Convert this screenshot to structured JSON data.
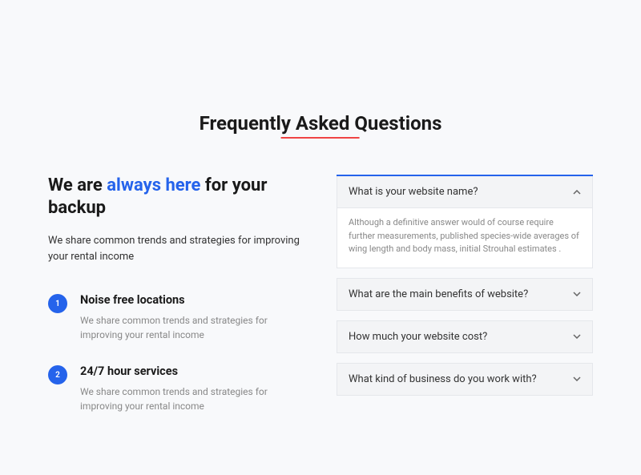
{
  "page_title": "Frequently Asked Questions",
  "subtitle": {
    "pre": "We are ",
    "highlight": "always here",
    "post": " for your backup"
  },
  "subtitle_desc": "We share common trends and strategies for improving your rental income",
  "features": [
    {
      "num": "1",
      "title": "Noise free locations",
      "desc": "We share common trends and strategies for improving your rental income"
    },
    {
      "num": "2",
      "title": "24/7 hour services",
      "desc": "We share common trends and strategies for improving your rental income"
    }
  ],
  "accordion": [
    {
      "title": "What is your website name?",
      "expanded": true,
      "body": "Although a definitive answer would of course require further measurements, published species-wide averages of wing length and body mass, initial Strouhal estimates ."
    },
    {
      "title": "What are the main benefits of website?",
      "expanded": false
    },
    {
      "title": "How much your website cost?",
      "expanded": false
    },
    {
      "title": "What kind of business do you work with?",
      "expanded": false
    }
  ]
}
